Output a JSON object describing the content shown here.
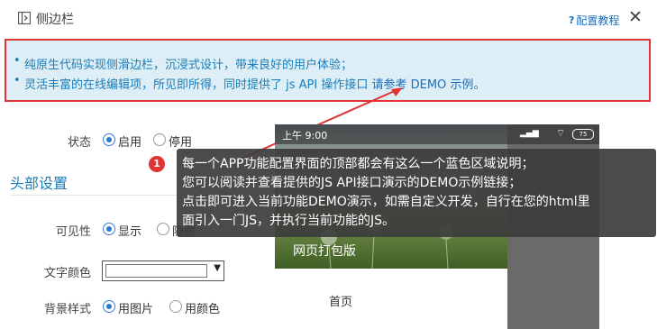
{
  "header": {
    "title": "侧边栏",
    "help_label": "配置教程",
    "close_glyph": "✕"
  },
  "info": {
    "line1": "纯原生代码实现侧滑边栏，沉浸式设计，带来良好的用户体验；",
    "line2_prefix": "灵活丰富的在线编辑项，所见即所得，同时提供了 js API 操作接口 ",
    "line2_link": "请参考 DEMO 示例",
    "line2_suffix": "。"
  },
  "form": {
    "status": {
      "label": "状态",
      "options": [
        "启用",
        "停用"
      ],
      "selected": "启用"
    },
    "section_title": "头部设置",
    "visibility": {
      "label": "可见性",
      "options": [
        "显示",
        "隐藏"
      ],
      "selected": "显示"
    },
    "text_color": {
      "label": "文字颜色",
      "value": "#ffffff"
    },
    "bg_style": {
      "label": "背景样式",
      "options": [
        "用图片",
        "用颜色"
      ],
      "selected": "用图片"
    }
  },
  "preview": {
    "time": "上午 9:00",
    "battery": "75",
    "app_title": "网页打包版",
    "home_item": "首页"
  },
  "tooltip": {
    "badge": "1",
    "lines": [
      "每一个APP功能配置界面的顶部都会有这么一个蓝色区域说明；",
      "您可以阅读并查看提供的JS API接口演示的DEMO示例链接；",
      "点击即可进入当前功能DEMO演示，如需自定义开发，自行在您的html里",
      "面引入一门JS，并执行当前功能的JS。"
    ]
  },
  "colors": {
    "accent_blue": "#1a7db8",
    "highlight_red": "#e03333",
    "info_bg": "#ddeef6"
  }
}
